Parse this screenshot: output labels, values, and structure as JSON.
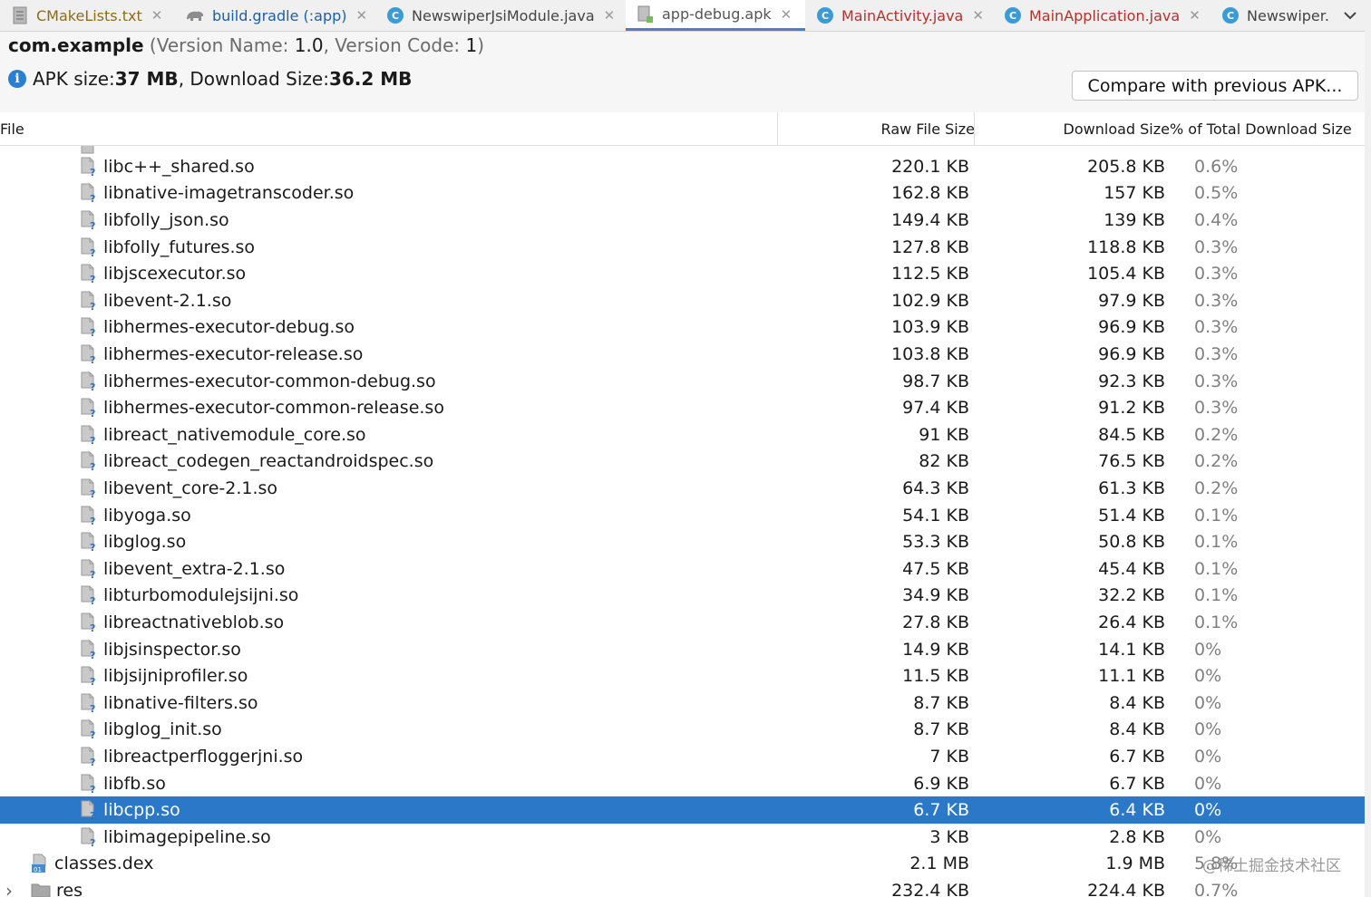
{
  "tabs": [
    {
      "label": "CMakeLists.txt",
      "icon": "text-file-icon"
    },
    {
      "label": "build.gradle (:app)",
      "icon": "gradle-elephant-icon"
    },
    {
      "label": "NewswiperJsiModule.java",
      "icon": "java-class-icon"
    },
    {
      "label": "app-debug.apk",
      "icon": "apk-file-icon",
      "active": true
    },
    {
      "label": "MainActivity.java",
      "icon": "java-class-icon"
    },
    {
      "label": "MainApplication.java",
      "icon": "java-class-icon"
    },
    {
      "label": "Newswiper.",
      "icon": "java-class-icon"
    }
  ],
  "header": {
    "package": "com.example",
    "version_open": " (Version Name: ",
    "version_name": "1.0",
    "version_mid": ", Version Code: ",
    "version_code": "1",
    "version_close": ")",
    "apk_size_label": "APK size: ",
    "apk_size": "37 MB",
    "download_size_label": ", Download Size: ",
    "download_size": "36.2 MB",
    "compare_button": "Compare with previous APK..."
  },
  "table": {
    "columns": [
      "File",
      "Raw File Size",
      "Download Size",
      "% of Total Download Size"
    ],
    "rows": [
      {
        "name": "libc++_shared.so",
        "raw": "220.1 KB",
        "download": "205.8 KB",
        "percent": "0.6%"
      },
      {
        "name": "libnative-imagetranscoder.so",
        "raw": "162.8 KB",
        "download": "157 KB",
        "percent": "0.5%"
      },
      {
        "name": "libfolly_json.so",
        "raw": "149.4 KB",
        "download": "139 KB",
        "percent": "0.4%"
      },
      {
        "name": "libfolly_futures.so",
        "raw": "127.8 KB",
        "download": "118.8 KB",
        "percent": "0.3%"
      },
      {
        "name": "libjscexecutor.so",
        "raw": "112.5 KB",
        "download": "105.4 KB",
        "percent": "0.3%"
      },
      {
        "name": "libevent-2.1.so",
        "raw": "102.9 KB",
        "download": "97.9 KB",
        "percent": "0.3%"
      },
      {
        "name": "libhermes-executor-debug.so",
        "raw": "103.9 KB",
        "download": "96.9 KB",
        "percent": "0.3%"
      },
      {
        "name": "libhermes-executor-release.so",
        "raw": "103.8 KB",
        "download": "96.9 KB",
        "percent": "0.3%"
      },
      {
        "name": "libhermes-executor-common-debug.so",
        "raw": "98.7 KB",
        "download": "92.3 KB",
        "percent": "0.3%"
      },
      {
        "name": "libhermes-executor-common-release.so",
        "raw": "97.4 KB",
        "download": "91.2 KB",
        "percent": "0.3%"
      },
      {
        "name": "libreact_nativemodule_core.so",
        "raw": "91 KB",
        "download": "84.5 KB",
        "percent": "0.2%"
      },
      {
        "name": "libreact_codegen_reactandroidspec.so",
        "raw": "82 KB",
        "download": "76.5 KB",
        "percent": "0.2%"
      },
      {
        "name": "libevent_core-2.1.so",
        "raw": "64.3 KB",
        "download": "61.3 KB",
        "percent": "0.2%"
      },
      {
        "name": "libyoga.so",
        "raw": "54.1 KB",
        "download": "51.4 KB",
        "percent": "0.1%"
      },
      {
        "name": "libglog.so",
        "raw": "53.3 KB",
        "download": "50.8 KB",
        "percent": "0.1%"
      },
      {
        "name": "libevent_extra-2.1.so",
        "raw": "47.5 KB",
        "download": "45.4 KB",
        "percent": "0.1%"
      },
      {
        "name": "libturbomodulejsijni.so",
        "raw": "34.9 KB",
        "download": "32.2 KB",
        "percent": "0.1%"
      },
      {
        "name": "libreactnativeblob.so",
        "raw": "27.8 KB",
        "download": "26.4 KB",
        "percent": "0.1%"
      },
      {
        "name": "libjsinspector.so",
        "raw": "14.9 KB",
        "download": "14.1 KB",
        "percent": "0%"
      },
      {
        "name": "libjsijniprofiler.so",
        "raw": "11.5 KB",
        "download": "11.1 KB",
        "percent": "0%"
      },
      {
        "name": "libnative-filters.so",
        "raw": "8.7 KB",
        "download": "8.4 KB",
        "percent": "0%"
      },
      {
        "name": "libglog_init.so",
        "raw": "8.7 KB",
        "download": "8.4 KB",
        "percent": "0%"
      },
      {
        "name": "libreactperfloggerjni.so",
        "raw": "7 KB",
        "download": "6.7 KB",
        "percent": "0%"
      },
      {
        "name": "libfb.so",
        "raw": "6.9 KB",
        "download": "6.7 KB",
        "percent": "0%"
      },
      {
        "name": "libcpp.so",
        "raw": "6.7 KB",
        "download": "6.4 KB",
        "percent": "0%",
        "selected": true
      },
      {
        "name": "libimagepipeline.so",
        "raw": "3 KB",
        "download": "2.8 KB",
        "percent": "0%"
      },
      {
        "name": "classes.dex",
        "raw": "2.1 MB",
        "download": "1.9 MB",
        "percent": "5.8%",
        "type": "dex"
      },
      {
        "name": "res",
        "raw": "232.4 KB",
        "download": "224.4 KB",
        "percent": "0.7%",
        "type": "folder"
      }
    ]
  },
  "watermark": "@稀土掘金技术社区",
  "colors": {
    "selection": "#2b78c9",
    "accent": "#4a7fd8",
    "java_icon": "#3c9bd4"
  }
}
